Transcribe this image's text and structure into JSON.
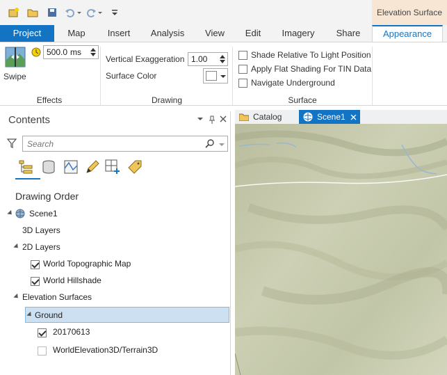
{
  "quick_access": {
    "icons": [
      "new-project-icon",
      "open-icon",
      "save-icon",
      "undo-icon",
      "redo-icon",
      "customize-icon"
    ]
  },
  "contextual_tab": {
    "label": "Elevation Surface"
  },
  "ribbon_tabs": [
    "Project",
    "Map",
    "Insert",
    "Analysis",
    "View",
    "Edit",
    "Imagery",
    "Share",
    "Appearance"
  ],
  "active_tab": "Appearance",
  "effects": {
    "swipe_label": "Swipe",
    "time_value": "500.0",
    "time_unit": "ms",
    "group_label": "Effects"
  },
  "drawing": {
    "vertical_exaggeration_label": "Vertical Exaggeration",
    "vertical_exaggeration_value": "1.00",
    "surface_color_label": "Surface Color",
    "group_label": "Drawing"
  },
  "surface": {
    "shade_relative": "Shade Relative To Light Position",
    "flat_shading": "Apply Flat Shading For TIN Data",
    "navigate_underground": "Navigate Underground",
    "group_label": "Surface"
  },
  "contents": {
    "title": "Contents",
    "search_placeholder": "Search",
    "section_title": "Drawing Order",
    "tree": {
      "scene": "Scene1",
      "layers_3d": "3D Layers",
      "layers_2d": "2D Layers",
      "topo": "World Topographic Map",
      "hillshade": "World Hillshade",
      "elevation_surfaces": "Elevation Surfaces",
      "ground": "Ground",
      "dem": "20170613",
      "terrain": "WorldElevation3D/Terrain3D"
    }
  },
  "doc_tabs": {
    "catalog": "Catalog",
    "scene": "Scene1"
  },
  "colors": {
    "accent": "#1474c4",
    "contextual": "#f7e6d4",
    "selection": "#cce0f2",
    "terrain": "#c9cdb0"
  }
}
